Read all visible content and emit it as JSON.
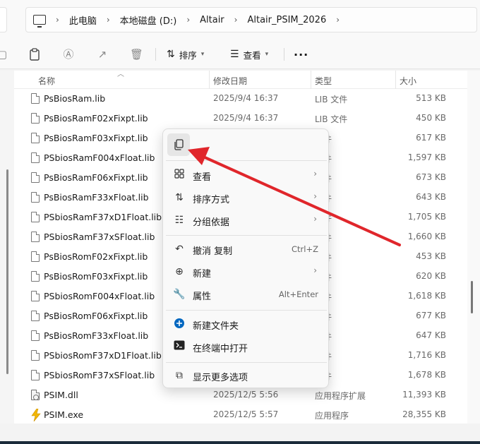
{
  "address": {
    "crumbs": [
      "此电脑",
      "本地磁盘 (D:)",
      "Altair",
      "Altair_PSIM_2026"
    ]
  },
  "toolbar": {
    "sort_label": "排序",
    "view_label": "查看",
    "more_label": "···"
  },
  "columns": {
    "name": "名称",
    "date": "修改日期",
    "type": "类型",
    "size": "大小"
  },
  "files": [
    {
      "name": "PsBiosRam.lib",
      "date": "2025/9/4 16:37",
      "type": "LIB 文件",
      "size": "513 KB"
    },
    {
      "name": "PsBiosRamF02xFixpt.lib",
      "date": "2025/9/4 16:37",
      "type": "LIB 文件",
      "size": "450 KB"
    },
    {
      "name": "PsBiosRamF03xFixpt.lib",
      "date": "",
      "type": "文件",
      "size": "617 KB"
    },
    {
      "name": "PSbiosRamF004xFloat.lib",
      "date": "",
      "type": "文件",
      "size": "1,597 KB"
    },
    {
      "name": "PsBiosRamF06xFixpt.lib",
      "date": "",
      "type": "文件",
      "size": "673 KB"
    },
    {
      "name": "PsBiosRamF33xFloat.lib",
      "date": "",
      "type": "文件",
      "size": "643 KB"
    },
    {
      "name": "PSbiosRamF37xD1Float.lib",
      "date": "",
      "type": "文件",
      "size": "1,705 KB"
    },
    {
      "name": "PSbiosRamF37xSFloat.lib",
      "date": "",
      "type": "文件",
      "size": "1,660 KB"
    },
    {
      "name": "PsBiosRomF02xFixpt.lib",
      "date": "",
      "type": "文件",
      "size": "453 KB"
    },
    {
      "name": "PsBiosRomF03xFixpt.lib",
      "date": "",
      "type": "文件",
      "size": "620 KB"
    },
    {
      "name": "PSbiosRomF004xFloat.lib",
      "date": "",
      "type": "文件",
      "size": "1,618 KB"
    },
    {
      "name": "PsBiosRomF06xFixpt.lib",
      "date": "",
      "type": "文件",
      "size": "677 KB"
    },
    {
      "name": "PsBiosRomF33xFloat.lib",
      "date": "",
      "type": "文件",
      "size": "647 KB"
    },
    {
      "name": "PSbiosRomF37xD1Float.lib",
      "date": "",
      "type": "文件",
      "size": "1,716 KB"
    },
    {
      "name": "PSbiosRomF37xSFloat.lib",
      "date": "",
      "type": "文件",
      "size": "1,678 KB"
    },
    {
      "name": "PSIM.dll",
      "date": "2025/12/5 5:56",
      "type": "应用程序扩展",
      "size": "11,393 KB"
    },
    {
      "name": "PSIM.exe",
      "date": "2025/12/5 5:57",
      "type": "应用程序",
      "size": "28,355 KB"
    }
  ],
  "menu": {
    "view": "查看",
    "sort": "排序方式",
    "group": "分组依据",
    "undo": "撤消 复制",
    "undo_key": "Ctrl+Z",
    "new": "新建",
    "properties": "属性",
    "properties_key": "Alt+Enter",
    "new_folder": "新建文件夹",
    "terminal": "在终端中打开",
    "more_options": "显示更多选项"
  },
  "colors": {
    "arrow": "#e0262b",
    "accent": "#0067c0"
  }
}
